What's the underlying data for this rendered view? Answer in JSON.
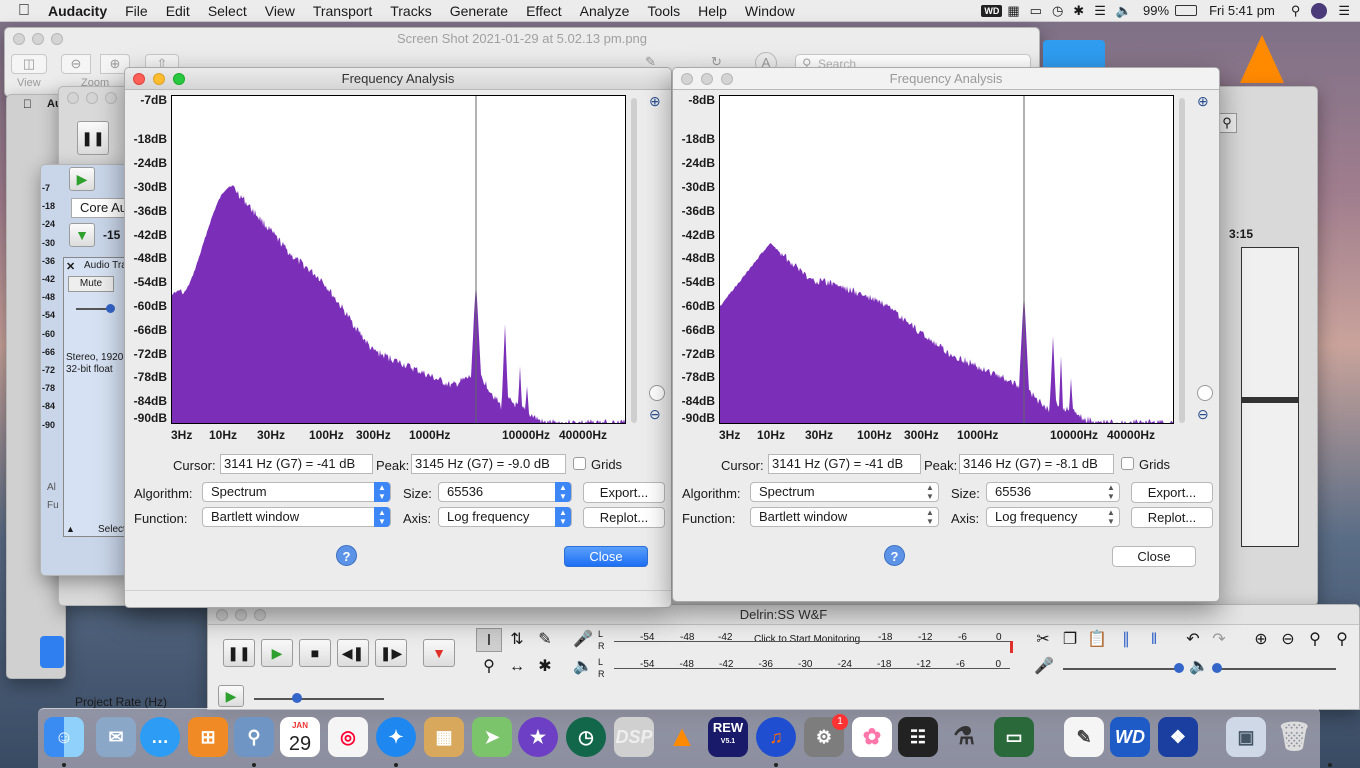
{
  "menubar": {
    "app": "Audacity",
    "items": [
      "File",
      "Edit",
      "Select",
      "View",
      "Transport",
      "Tracks",
      "Generate",
      "Effect",
      "Analyze",
      "Tools",
      "Help",
      "Window"
    ],
    "battery": "99%",
    "clock": "Fri 5:41 pm"
  },
  "preview": {
    "title": "Screen Shot 2021-01-29 at 5.02.13 pm.png",
    "view_label": "View",
    "zoom_label": "Zoom",
    "search_placeholder": "Search"
  },
  "bg_audacity": {
    "device": "Core Au",
    "meter_val": "-15",
    "time": "3:15",
    "track_name": "Audio Tra",
    "mute": "Mute",
    "info1": "Stereo, 1920",
    "info2": "32-bit float",
    "select": "Select",
    "left_scale": [
      "-7",
      "-18",
      "-24",
      "-30",
      "-36",
      "-42",
      "-48",
      "-54",
      "-60",
      "-66",
      "-72",
      "-78",
      "-84",
      "-90"
    ],
    "cut_text": [
      "Al",
      "Fu"
    ],
    "right_fragment": "s"
  },
  "dialog_left": {
    "title": "Frequency Analysis",
    "db_labels": [
      "-7dB",
      "-18dB",
      "-24dB",
      "-30dB",
      "-36dB",
      "-42dB",
      "-48dB",
      "-54dB",
      "-60dB",
      "-66dB",
      "-72dB",
      "-78dB",
      "-84dB",
      "-90dB"
    ],
    "hz_labels": [
      "3Hz",
      "10Hz",
      "30Hz",
      "100Hz",
      "300Hz",
      "1000Hz",
      "10000Hz",
      "40000Hz"
    ],
    "cursor_label": "Cursor:",
    "cursor_value": "3141 Hz (G7) = -41 dB",
    "peak_label": "Peak:",
    "peak_value": "3145 Hz (G7) = -9.0 dB",
    "grids_label": "Grids",
    "algorithm_label": "Algorithm:",
    "algorithm_value": "Spectrum",
    "size_label": "Size:",
    "size_value": "65536",
    "function_label": "Function:",
    "function_value": "Bartlett window",
    "axis_label": "Axis:",
    "axis_value": "Log frequency",
    "export_label": "Export...",
    "replot_label": "Replot...",
    "close_label": "Close",
    "help": "?",
    "accent": "#7b2fb8"
  },
  "dialog_right": {
    "title": "Frequency Analysis",
    "db_labels": [
      "-8dB",
      "-18dB",
      "-24dB",
      "-30dB",
      "-36dB",
      "-42dB",
      "-48dB",
      "-54dB",
      "-60dB",
      "-66dB",
      "-72dB",
      "-78dB",
      "-84dB",
      "-90dB"
    ],
    "hz_labels": [
      "3Hz",
      "10Hz",
      "30Hz",
      "100Hz",
      "300Hz",
      "1000Hz",
      "10000Hz",
      "40000Hz"
    ],
    "cursor_label": "Cursor:",
    "cursor_value": "3141 Hz (G7) = -41 dB",
    "peak_label": "Peak:",
    "peak_value": "3146 Hz (G7) = -8.1 dB",
    "grids_label": "Grids",
    "algorithm_label": "Algorithm:",
    "algorithm_value": "Spectrum",
    "size_label": "Size:",
    "size_value": "65536",
    "function_label": "Function:",
    "function_value": "Bartlett window",
    "axis_label": "Axis:",
    "axis_value": "Log frequency",
    "export_label": "Export...",
    "replot_label": "Replot...",
    "close_label": "Close",
    "help": "?"
  },
  "main_window": {
    "title": "Delrin:SS W&F",
    "meter_ticks": [
      "-54",
      "-48",
      "-42",
      "-18",
      "-12",
      "-6",
      "0"
    ],
    "meter_ticks2": [
      "-54",
      "-48",
      "-42",
      "-36",
      "-30",
      "-24",
      "-18",
      "-12",
      "-6",
      "0"
    ],
    "monitor": "Click to Start Monitoring",
    "project_rate": "Project Rate (Hz)",
    "L": "L",
    "R": "R"
  },
  "dock": {
    "calendar_month": "JAN",
    "calendar_day": "29",
    "badge": "1",
    "rew": "REW",
    "rew_ver": "V5.1",
    "dsp": "DSP",
    "wd": "WD"
  }
}
